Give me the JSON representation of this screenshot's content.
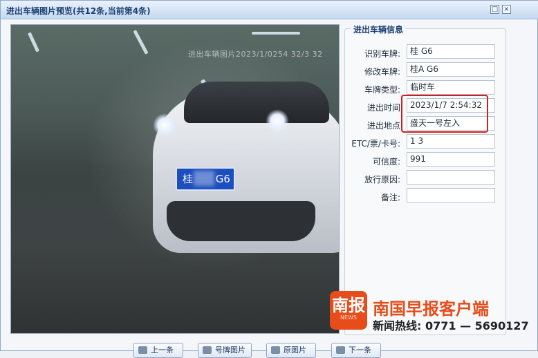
{
  "window": {
    "title": "进出车辆图片预览(共12条,当前第4条)",
    "maximize_glyph": "□",
    "close_glyph": "×"
  },
  "preview": {
    "overlay_text": "进出车辆图片2023/1/0254 32/3   32  ",
    "plate_left": "桂",
    "plate_right": "G6"
  },
  "info": {
    "legend": "进出车辆信息",
    "fields": [
      {
        "label": "识别车牌:",
        "value": "桂      G6"
      },
      {
        "label": "修改车牌:",
        "value": "桂A    G6"
      },
      {
        "label": "车牌类型:",
        "value": "临时车"
      },
      {
        "label": "进出时间",
        "value": "2023/1/7 2:54:32"
      },
      {
        "label": "进出地点",
        "value": "盛天一号左入"
      },
      {
        "label": "ETC/票/卡号:",
        "value": "  1  3   "
      },
      {
        "label": "可信度:",
        "value": "991"
      },
      {
        "label": "放行原因:",
        "value": ""
      },
      {
        "label": "备注:",
        "value": ""
      }
    ]
  },
  "buttons": {
    "prev": "上一条",
    "plate_image": "号牌图片",
    "original_image": "原图片",
    "next": "下一条"
  },
  "watermark": {
    "logo_text": "南报",
    "logo_sub": "NEWS",
    "brand": "南国早报客户端",
    "hotline": "新闻热线: 0771 — 5690127"
  },
  "colors": {
    "highlight": "#d11d1d",
    "brand": "#e74c1b",
    "titlebar": "#c6d9f0"
  }
}
